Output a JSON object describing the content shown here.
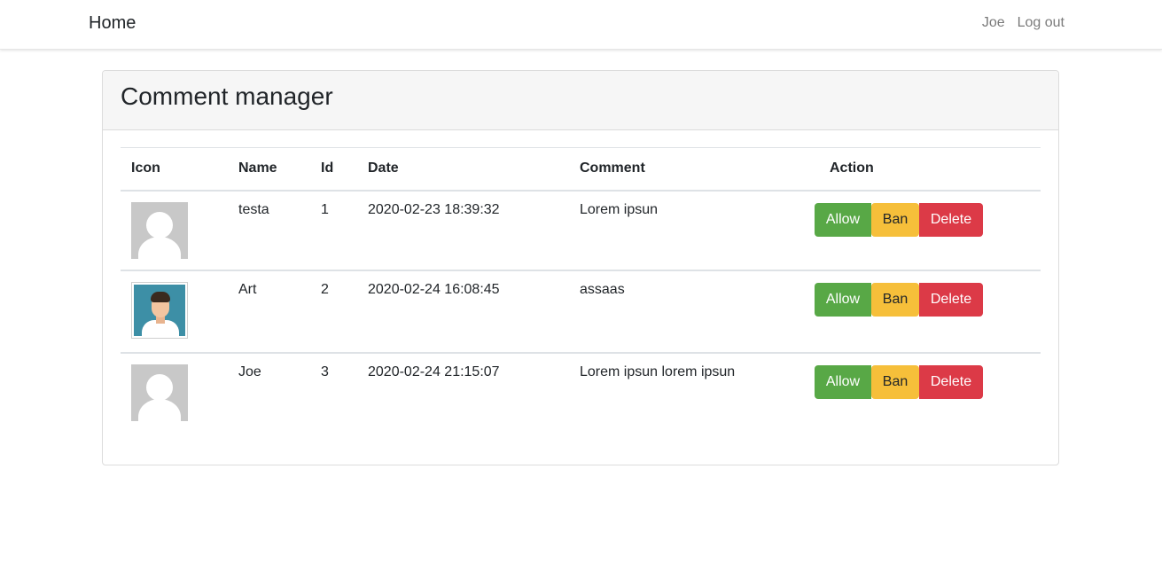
{
  "navbar": {
    "brand": "Home",
    "user": "Joe",
    "logout": "Log out"
  },
  "card": {
    "title": "Comment manager"
  },
  "table": {
    "headers": {
      "icon": "Icon",
      "name": "Name",
      "id": "Id",
      "date": "Date",
      "comment": "Comment",
      "action": "Action"
    },
    "rows": [
      {
        "avatar": "default-avatar-icon",
        "name": "testa",
        "id": "1",
        "date": "2020-02-23 18:39:32",
        "comment": "Lorem ipsun"
      },
      {
        "avatar": "user-photo-avatar",
        "name": "Art",
        "id": "2",
        "date": "2020-02-24 16:08:45",
        "comment": "assaas"
      },
      {
        "avatar": "default-avatar-icon",
        "name": "Joe",
        "id": "3",
        "date": "2020-02-24 21:15:07",
        "comment": "Lorem ipsun lorem ipsun"
      }
    ],
    "buttons": {
      "allow": "Allow",
      "ban": "Ban",
      "delete": "Delete"
    }
  },
  "colors": {
    "allow": "#58a846",
    "ban": "#f6bf3a",
    "delete": "#dc3a47",
    "header_bg": "#f6f6f6"
  }
}
